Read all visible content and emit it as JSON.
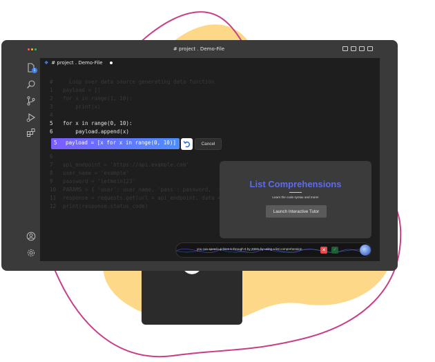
{
  "window": {
    "title": "# project . Demo-File",
    "traffic_colors": [
      "#ff5f57",
      "#febc2e",
      "#28c840"
    ]
  },
  "activitybar": {
    "explorer_badge": "1",
    "icons": [
      "files-icon",
      "search-icon",
      "source-control-icon",
      "run-debug-icon",
      "extensions-icon",
      "account-icon",
      "settings-gear-icon"
    ]
  },
  "editor": {
    "tab_label": "# project . Demo-File",
    "lines": [
      {
        "n": "#",
        "text": "  Loop over data source generating data function"
      },
      {
        "n": "1",
        "text": "payload = []"
      },
      {
        "n": "2",
        "text": "for x in range(1, 10):"
      },
      {
        "n": "3",
        "text": "    print(x)"
      },
      {
        "n": "4",
        "text": ""
      },
      {
        "n": "5",
        "text": "for x in range(0, 10):"
      },
      {
        "n": "6",
        "text": "    payload.append(x)"
      },
      {
        "n": "5",
        "text": "payload = [x for x in range(0, 10)]"
      },
      {
        "n": "6",
        "text": ""
      },
      {
        "n": "7",
        "text": "api_endpoint = 'https://api.example.com'"
      },
      {
        "n": "8",
        "text": "user_name = 'example'"
      },
      {
        "n": "9",
        "text": "password = 'letmein123'"
      },
      {
        "n": "10",
        "text": "PARAMS = { 'user': user_name, 'pass': password,  'role':"
      },
      {
        "n": "11",
        "text": "response = requests.get(url = api_endpoint, data = PARAMS)"
      },
      {
        "n": "12",
        "text": "print(response.status_code)"
      }
    ],
    "suggestion": {
      "line_number": "5",
      "code": "payload = [x for x in range(0, 10)]",
      "cancel_label": "Cancel"
    }
  },
  "tutor": {
    "title": "List Comprehensions",
    "subtitle": "Learn the code syntax and more!",
    "button_label": "Launch Interactive Tutor",
    "title_color": "#5d6bf0"
  },
  "notification": {
    "text": "you can speed up lines 5 through 6 by 200% by using a list comprehension",
    "dismiss_symbol": "✕",
    "accept_symbol": "✓"
  },
  "colors": {
    "blob_yellow": "#fdd889",
    "outline_pink": "#c73e86",
    "suggestion_gradient": [
      "#7b5cff",
      "#4d8dff"
    ]
  }
}
